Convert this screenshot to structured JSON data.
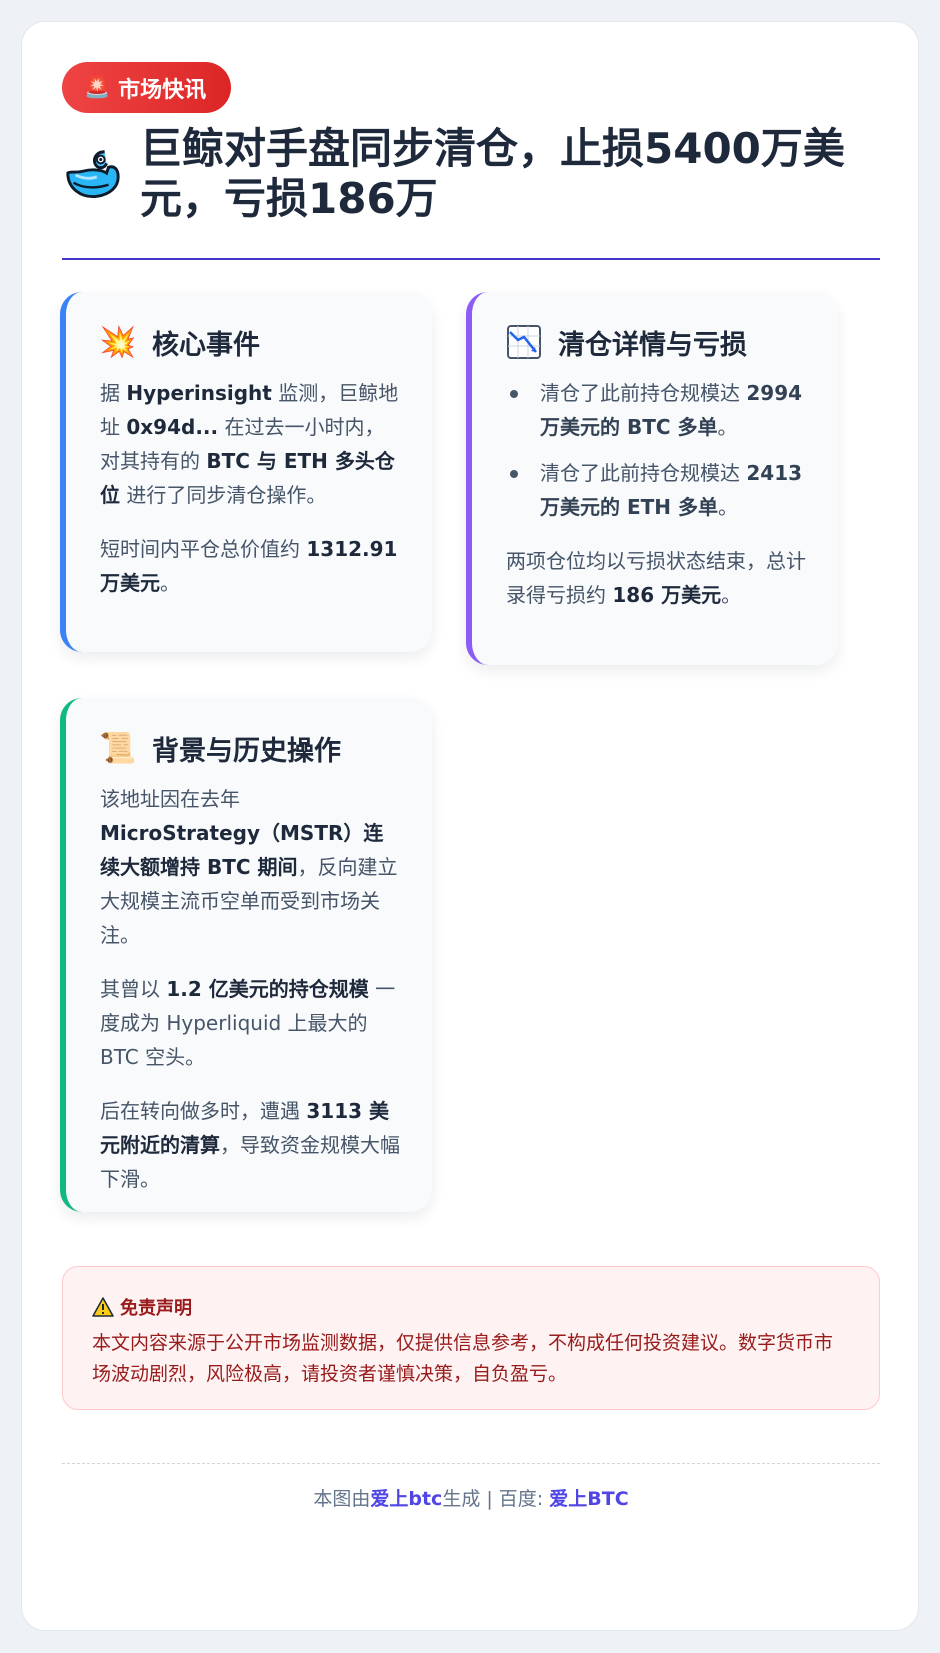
{
  "badge": {
    "icon": "siren-icon",
    "glyph": "🚨",
    "label": "市场快讯"
  },
  "header": {
    "icon": "whale-icon",
    "title": "巨鲸对手盘同步清仓，止损5400万美元，亏损186万"
  },
  "colors": {
    "accent": "#4338ca",
    "badge_red": "#ef4444",
    "panel_blue": "#3b82f6",
    "panel_purple": "#8b5cf6",
    "panel_green": "#10b981",
    "disclaimer_text": "#991b1b",
    "link": "#4f46e5"
  },
  "core": {
    "icon": "collision-icon",
    "glyph": "💥",
    "title": "核心事件",
    "p1": {
      "t1": "据 ",
      "b1": "Hyperinsight",
      "t2": " 监测，巨鲸地址 ",
      "b2": "0x94d...",
      "t3": " 在过去一小时内，对其持有的 ",
      "b3": "BTC 与 ETH 多头仓位",
      "t4": " 进行了同步清仓操作。"
    },
    "p2": {
      "t1": "短时间内平仓总价值约 ",
      "b1": "1312.91 万美元",
      "t2": "。"
    }
  },
  "details": {
    "icon": "chart-decreasing-icon",
    "title": "清仓详情与亏损",
    "items": [
      {
        "t1": "清仓了此前持仓规模达 ",
        "b1": "2994 万美元的 BTC 多单",
        "t2": "。"
      },
      {
        "t1": "清仓了此前持仓规模达 ",
        "b1": "2413 万美元的 ETH 多单",
        "t2": "。"
      }
    ],
    "summary": {
      "t1": "两项仓位均以亏损状态结束，总计录得亏损约 ",
      "b1": "186 万美元",
      "t2": "。"
    }
  },
  "background": {
    "icon": "scroll-icon",
    "glyph": "📜",
    "title": "背景与历史操作",
    "p1": {
      "t1": "该地址因在去年 ",
      "b1": "MicroStrategy（MSTR）连续大额增持 BTC 期间",
      "t2": "，反向建立大规模主流币空单而受到市场关注。"
    },
    "p2": {
      "t1": "其曾以 ",
      "b1": "1.2 亿美元的持仓规模",
      "t2": " 一度成为 Hyperliquid 上最大的 BTC 空头。"
    },
    "p3": {
      "t1": "后在转向做多时，遭遇 ",
      "b1": "3113 美元附近的清算",
      "t2": "，导致资金规模大幅下滑。"
    }
  },
  "disclaimer": {
    "icon": "warning-icon",
    "glyph": "⚠",
    "title": "免责声明",
    "text": "本文内容来源于公开市场监测数据，仅提供信息参考，不构成任何投资建议。数字货币市场波动剧烈，风险极高，请投资者谨慎决策，自负盈亏。"
  },
  "footer": {
    "prefix": "本图由",
    "brand": "爱上btc",
    "middle": "生成 | 百度: ",
    "baidu": "爱上BTC"
  }
}
